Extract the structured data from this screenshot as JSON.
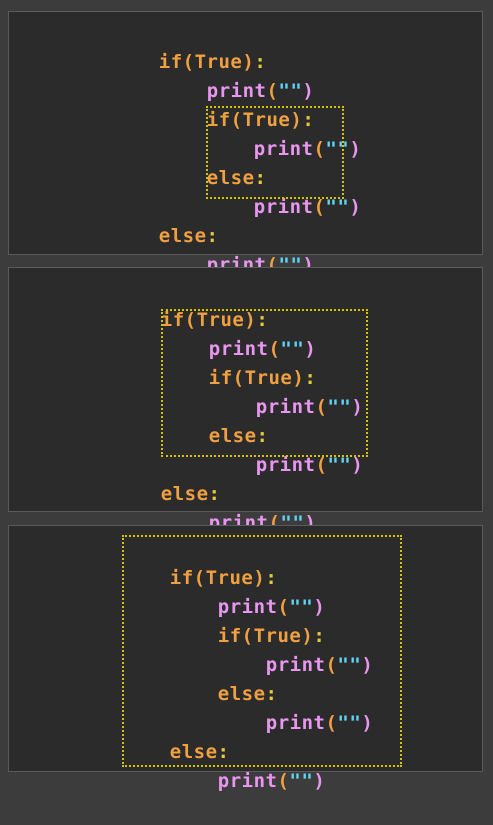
{
  "tokens": {
    "if_kw": "if",
    "else_kw": "else",
    "print_fn": "print",
    "true_kw": "True",
    "lparen": "(",
    "rparen": ")",
    "empty_str": "\"\"",
    "colon": ":"
  },
  "colors": {
    "background": "#3c3c3c",
    "panel": "#2b2b2b",
    "keyword": "#f0a040",
    "function": "#e896f0",
    "string": "#5fd3f5",
    "highlight_box": "#d4c20a"
  },
  "panels": [
    {
      "highlight": "inner if/else bodies"
    },
    {
      "highlight": "outer if body"
    },
    {
      "highlight": "entire if/else statement"
    }
  ]
}
